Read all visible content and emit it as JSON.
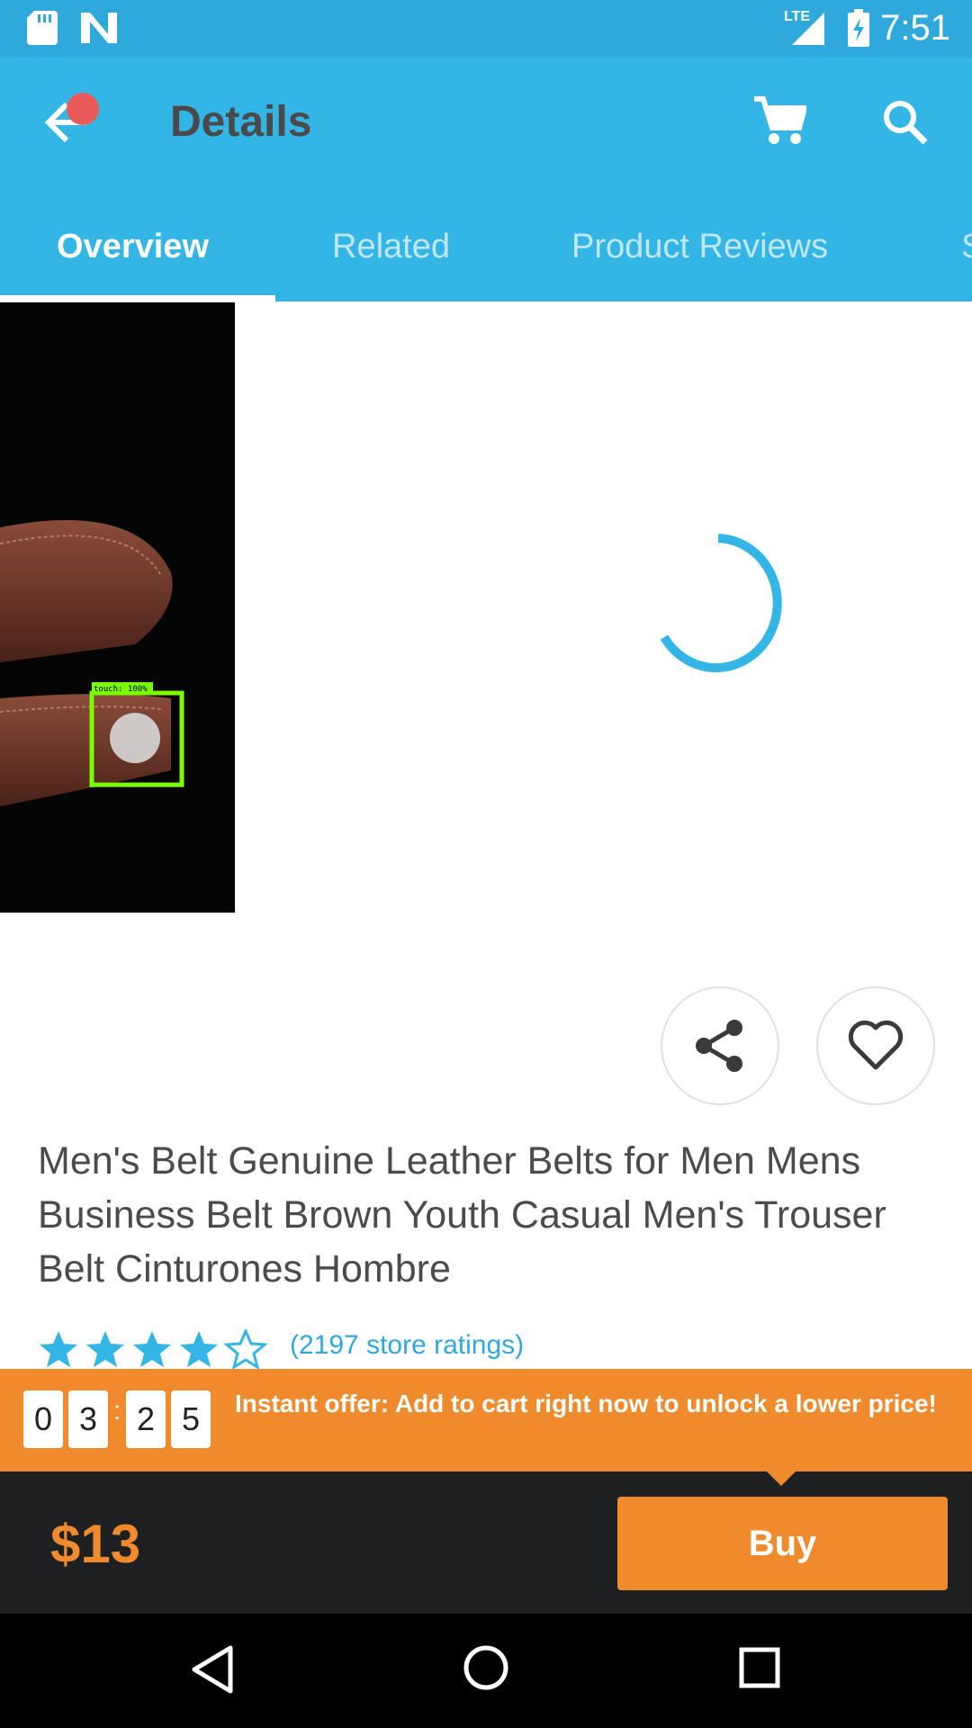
{
  "status_bar": {
    "time": "7:51",
    "network": "LTE"
  },
  "app_bar": {
    "title": "Details"
  },
  "tabs": [
    {
      "label": "Overview"
    },
    {
      "label": "Related"
    },
    {
      "label": "Product Reviews"
    },
    {
      "label": "S"
    }
  ],
  "product_image": {
    "overlay_label": "touch: 100%"
  },
  "product": {
    "name": "Men's Belt Genuine Leather Belts for Men Mens Business Belt Brown Youth Casual Men's Trouser Belt Cinturones Hombre",
    "rating": 4.5,
    "ratings_text": "(2197 store ratings)"
  },
  "offer": {
    "timer": [
      "0",
      "3",
      "2",
      "5"
    ],
    "separator": ":",
    "text": "Instant offer: Add to cart right now to unlock a lower price!"
  },
  "bottom": {
    "price": "$13",
    "buy_label": "Buy"
  },
  "colors": {
    "primary": "#33b5e5",
    "accent": "#ef8b2c",
    "bar_dark": "#1d1f21"
  }
}
